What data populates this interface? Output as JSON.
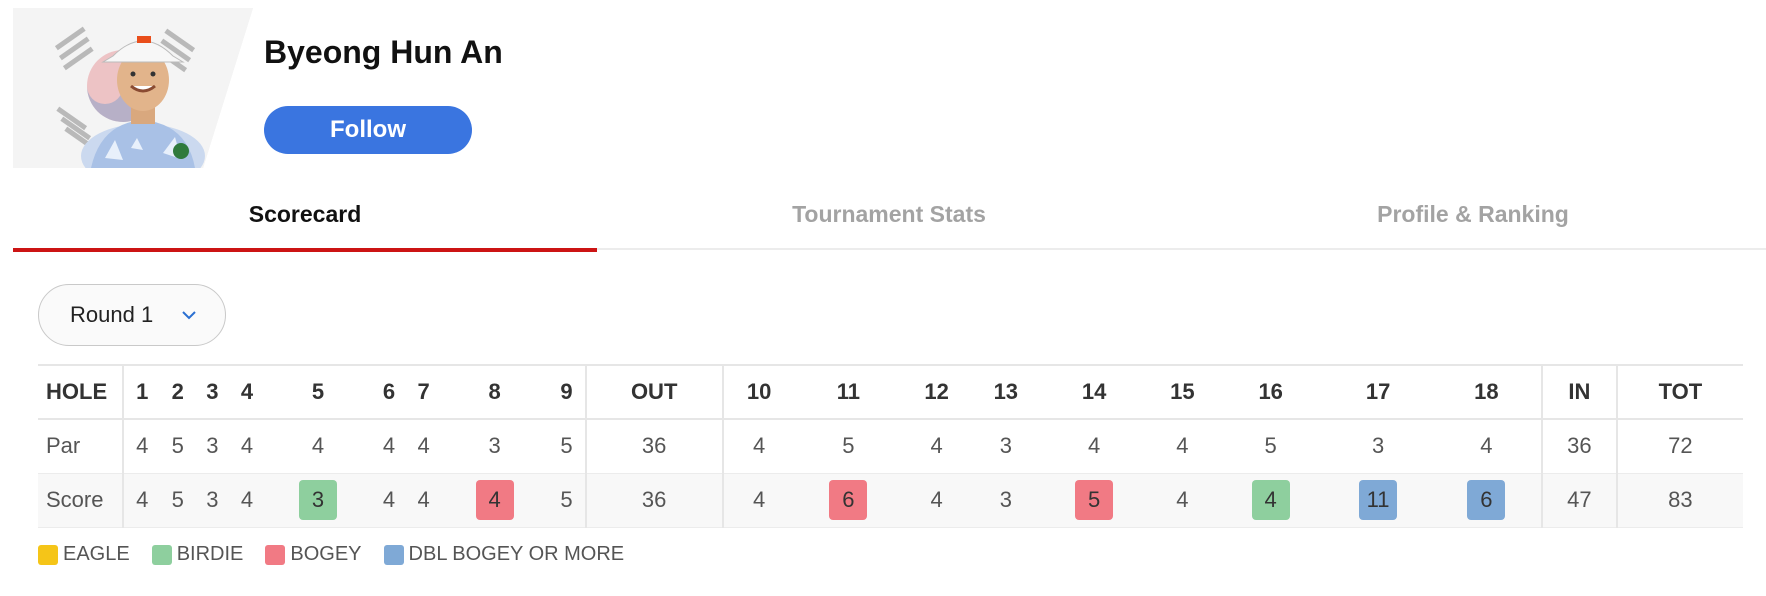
{
  "player": {
    "name": "Byeong Hun An",
    "follow_label": "Follow"
  },
  "tabs": [
    {
      "label": "Scorecard",
      "active": true
    },
    {
      "label": "Tournament Stats",
      "active": false
    },
    {
      "label": "Profile & Ranking",
      "active": false
    }
  ],
  "round_select": {
    "value": "Round 1"
  },
  "scorecard": {
    "headers": [
      "HOLE",
      "1",
      "2",
      "3",
      "4",
      "5",
      "6",
      "7",
      "8",
      "9",
      "OUT",
      "10",
      "11",
      "12",
      "13",
      "14",
      "15",
      "16",
      "17",
      "18",
      "IN",
      "TOT"
    ],
    "par": [
      "Par",
      "4",
      "5",
      "3",
      "4",
      "4",
      "4",
      "4",
      "3",
      "5",
      "36",
      "4",
      "5",
      "4",
      "3",
      "4",
      "4",
      "5",
      "3",
      "4",
      "36",
      "72"
    ],
    "score": [
      "Score",
      "4",
      "5",
      "3",
      "4",
      "3",
      "4",
      "4",
      "4",
      "5",
      "36",
      "4",
      "6",
      "4",
      "3",
      "5",
      "4",
      "4",
      "11",
      "6",
      "47",
      "83"
    ],
    "score_types": [
      "",
      "",
      "",
      "",
      "",
      "birdie",
      "",
      "",
      "bogey",
      "",
      "",
      "",
      "bogey",
      "",
      "",
      "bogey",
      "",
      "birdie",
      "dbl",
      "dbl",
      "",
      ""
    ]
  },
  "legend": [
    {
      "label": "EAGLE",
      "color": "#f5c518"
    },
    {
      "label": "BIRDIE",
      "color": "#8ecf9e"
    },
    {
      "label": "BOGEY",
      "color": "#f17a84"
    },
    {
      "label": "DBL BOGEY OR MORE",
      "color": "#7fa9d6"
    }
  ],
  "colors": {
    "accent": "#3a75e0",
    "active_tab": "#cc1414"
  }
}
